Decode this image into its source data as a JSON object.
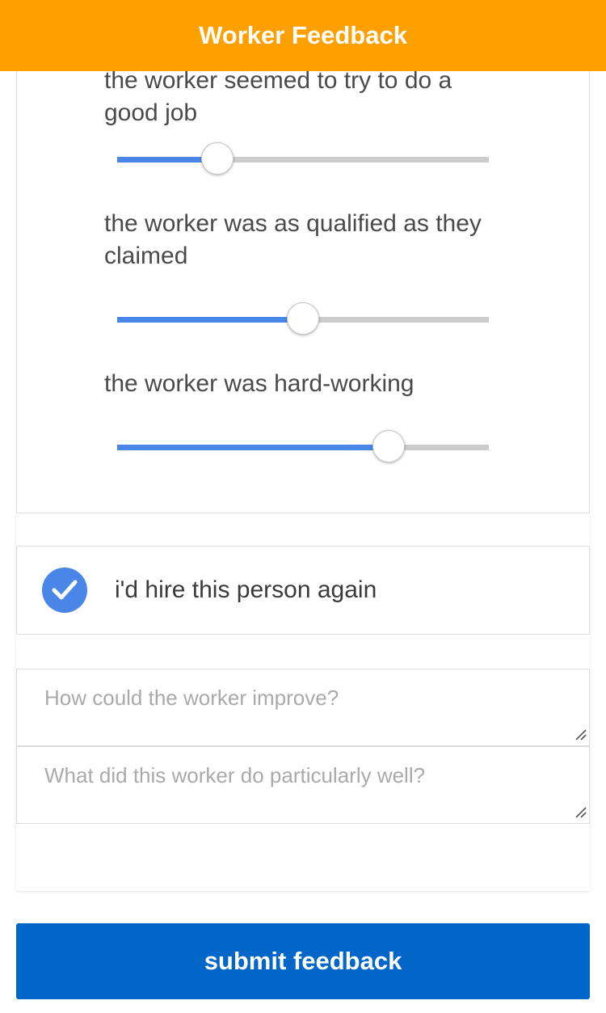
{
  "header": {
    "title": "Worker Feedback"
  },
  "ratings": [
    {
      "question": "the worker seemed to try to do a good job",
      "value_fraction": 0.27
    },
    {
      "question": "the worker was as qualified as they claimed",
      "value_fraction": 0.5
    },
    {
      "question": "the worker was hard-working",
      "value_fraction": 0.73
    }
  ],
  "hire_again": {
    "label": "i'd hire this person again",
    "checked": true
  },
  "improve_field": {
    "placeholder": "How could the worker improve?",
    "value": ""
  },
  "well_field": {
    "placeholder": "What did this worker do particularly well?",
    "value": ""
  },
  "submit": {
    "label": "submit feedback"
  },
  "colors": {
    "header": "#ffa000",
    "accent": "#4a86e8",
    "button": "#0066c7"
  }
}
